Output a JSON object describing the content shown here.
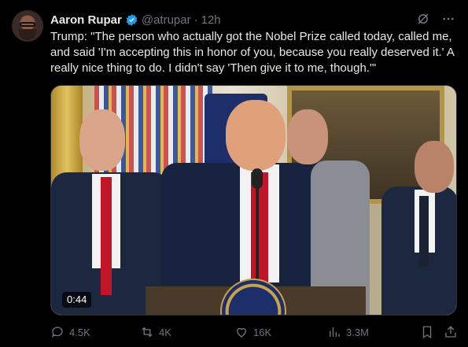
{
  "tweet": {
    "author_name": "Aaron Rupar",
    "handle": "@atrupar",
    "separator": "·",
    "time": "12h",
    "text": "Trump: \"The person who actually got the Nobel Prize called today, called me, and said 'I'm accepting this in honor of you, because you really deserved it.' A really nice thing to do. I didn't say 'Then give it to me, though.'\"",
    "media": {
      "type": "video",
      "duration": "0:44",
      "podium_seal_text": "PRESIDENT OF THE UNITED STATES"
    },
    "actions": {
      "replies": "4.5K",
      "reposts": "4K",
      "likes": "16K",
      "views": "3.3M"
    }
  },
  "colors": {
    "background": "#000000",
    "text": "#e7e9ea",
    "muted": "#71767b",
    "verified": "#1d9bf0"
  },
  "icons": {
    "verified": "verified-badge-icon",
    "grok": "grok-icon",
    "more": "more-icon",
    "reply": "reply-icon",
    "repost": "repost-icon",
    "like": "like-icon",
    "views": "views-icon",
    "bookmark": "bookmark-icon",
    "share": "share-icon"
  }
}
